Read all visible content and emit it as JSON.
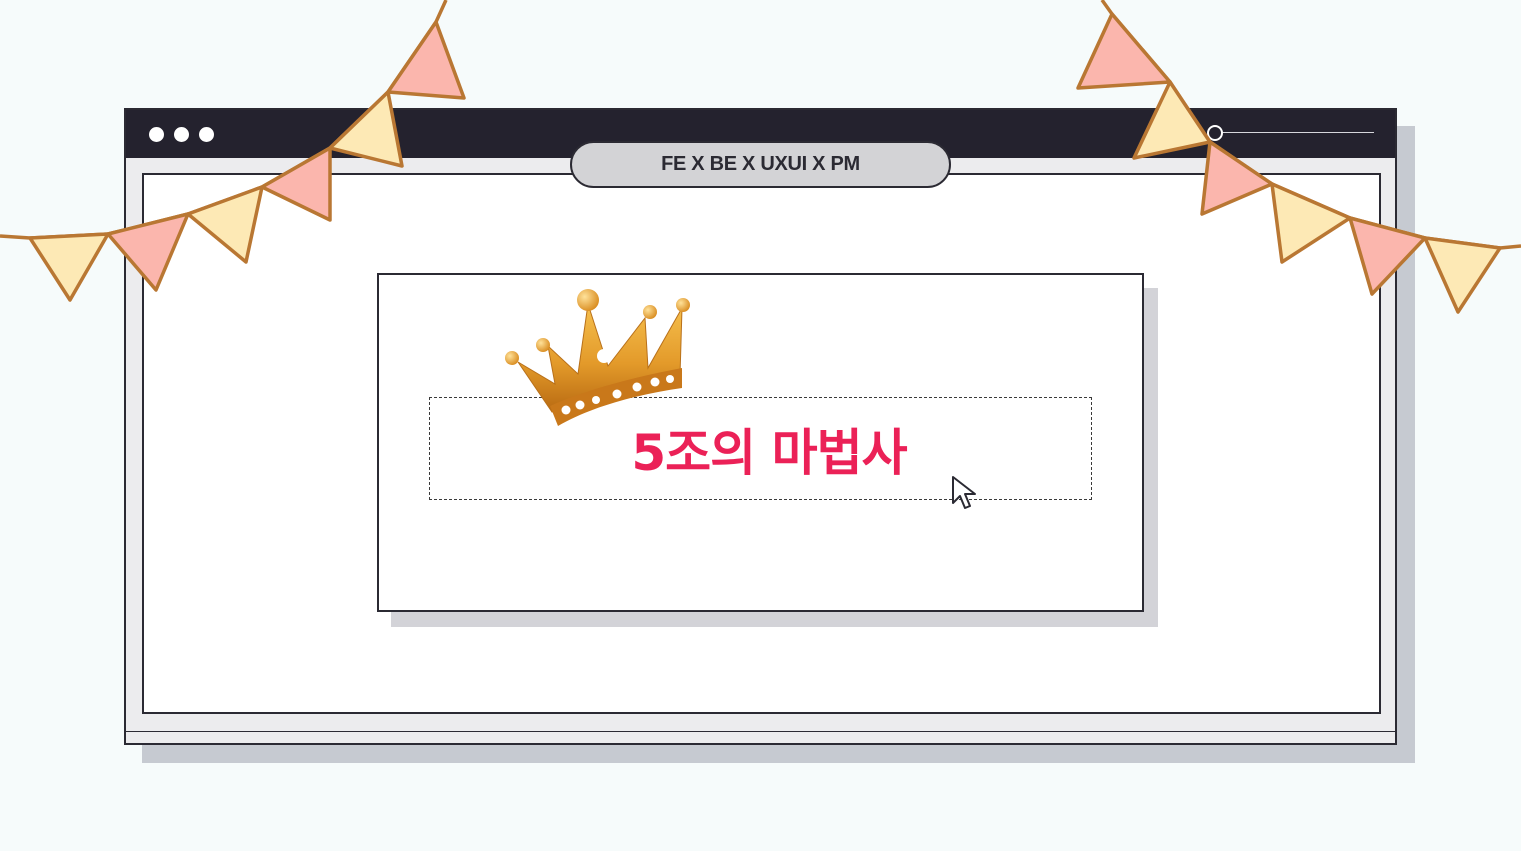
{
  "window": {
    "tab_label": "FE X BE X UXUI X PM"
  },
  "card": {
    "title": "5조의 마법사"
  },
  "icons": {
    "crown": "crown-icon",
    "cursor": "mouse-cursor-icon",
    "bunting": "party-bunting-flags"
  },
  "colors": {
    "background": "#f6fbfb",
    "titlebar": "#24222e",
    "title_text": "#eb2157",
    "flag_pink": "#fbb6ad",
    "flag_yellow": "#fde9b5",
    "flag_border": "#b97733",
    "crown_gold": "#e39a2a"
  }
}
